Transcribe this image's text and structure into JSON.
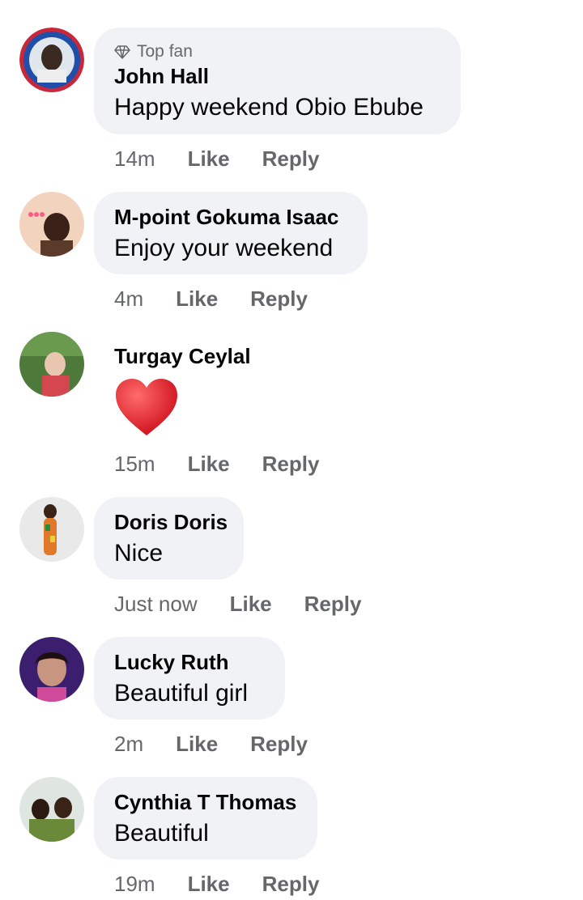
{
  "comments": [
    {
      "badge": "Top fan",
      "name": "John Hall",
      "text": "Happy weekend Obio Ebube",
      "time": "14m",
      "like": "Like",
      "reply": "Reply"
    },
    {
      "name": "M-point Gokuma Isaac",
      "text": "Enjoy your weekend",
      "time": "4m",
      "like": "Like",
      "reply": "Reply"
    },
    {
      "name": "Turgay Ceylal",
      "text": "",
      "time": "15m",
      "like": "Like",
      "reply": "Reply",
      "sticker_icon": "red-heart-icon"
    },
    {
      "name": "Doris Doris",
      "text": "Nice",
      "time": "Just now",
      "like": "Like",
      "reply": "Reply"
    },
    {
      "name": "Lucky Ruth",
      "text": "Beautiful girl",
      "time": "2m",
      "like": "Like",
      "reply": "Reply"
    },
    {
      "name": "Cynthia T Thomas",
      "text": "Beautiful",
      "time": "19m",
      "like": "Like",
      "reply": "Reply"
    }
  ],
  "colors": {
    "bubble_bg": "#f0f2f5",
    "secondary_text": "#65676b",
    "primary_text": "#050505",
    "heart": "#e0242e"
  }
}
